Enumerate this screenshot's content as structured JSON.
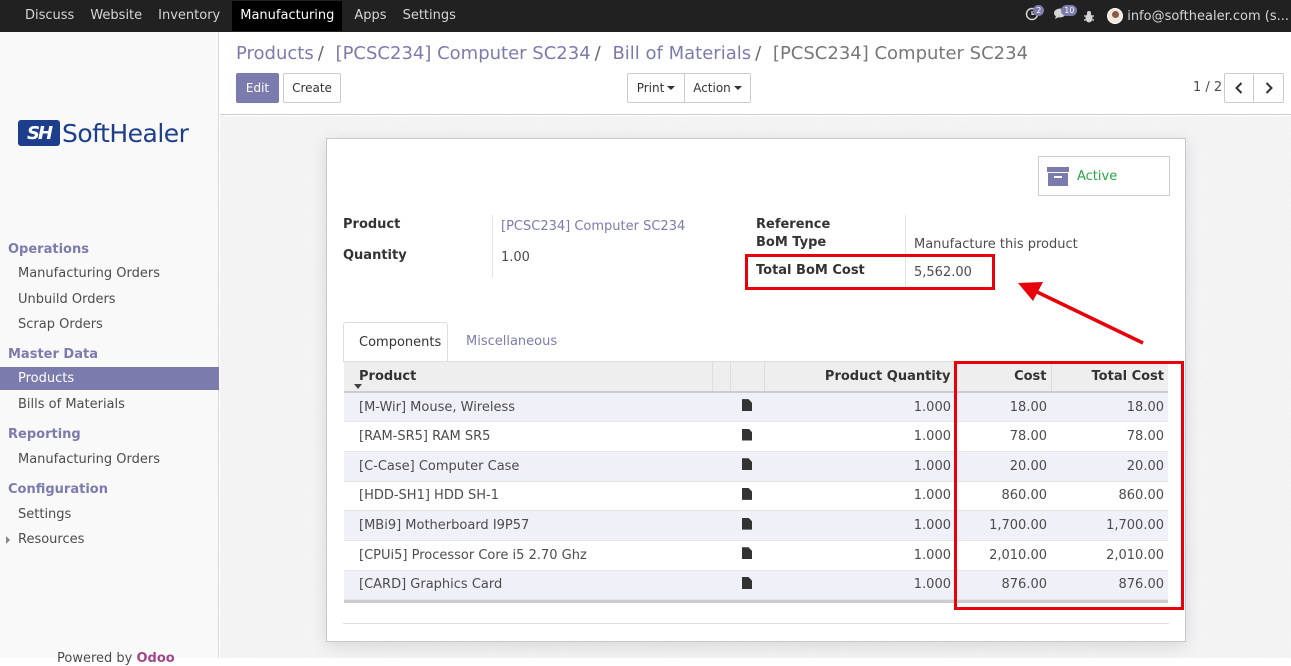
{
  "topbar": {
    "apps": [
      "Discuss",
      "Website",
      "Inventory",
      "Manufacturing",
      "Apps",
      "Settings"
    ],
    "active_app": "Manufacturing",
    "activity_badge": "2",
    "messages_badge": "10",
    "user_email": "info@softhealer.com (s..."
  },
  "sidebar": {
    "logo_mark": "SH",
    "logo_text": "SoftHealer",
    "sections": [
      {
        "title": "Operations",
        "items": [
          "Manufacturing Orders",
          "Unbuild Orders",
          "Scrap Orders"
        ]
      },
      {
        "title": "Master Data",
        "items": [
          "Products",
          "Bills of Materials"
        ]
      },
      {
        "title": "Reporting",
        "items": [
          "Manufacturing Orders"
        ]
      },
      {
        "title": "Configuration",
        "items": [
          "Settings",
          "Resources"
        ]
      }
    ],
    "active_item": "Products",
    "powered_by": "Powered by",
    "powered_brand": "Odoo"
  },
  "breadcrumb": [
    "Products",
    "[PCSC234] Computer SC234",
    "Bill of Materials",
    "[PCSC234] Computer SC234"
  ],
  "toolbar": {
    "edit": "Edit",
    "create": "Create",
    "print": "Print",
    "action": "Action",
    "pager": "1 / 2"
  },
  "form": {
    "active_label": "Active",
    "product_label": "Product",
    "product_value": "[PCSC234] Computer SC234",
    "quantity_label": "Quantity",
    "quantity_value": "1.00",
    "reference_label": "Reference",
    "bom_type_label": "BoM Type",
    "bom_type_value": "Manufacture this product",
    "total_cost_label": "Total BoM Cost",
    "total_cost_value": "5,562.00"
  },
  "tabs": [
    "Components",
    "Miscellaneous"
  ],
  "table": {
    "headers": {
      "product": "Product",
      "qty": "Product Quantity",
      "cost": "Cost",
      "total": "Total Cost"
    },
    "rows": [
      {
        "product": "[M-Wir] Mouse, Wireless",
        "qty": "1.000",
        "cost": "18.00",
        "total": "18.00"
      },
      {
        "product": "[RAM-SR5] RAM SR5",
        "qty": "1.000",
        "cost": "78.00",
        "total": "78.00"
      },
      {
        "product": "[C-Case] Computer Case",
        "qty": "1.000",
        "cost": "20.00",
        "total": "20.00"
      },
      {
        "product": "[HDD-SH1] HDD SH-1",
        "qty": "1.000",
        "cost": "860.00",
        "total": "860.00"
      },
      {
        "product": "[MBi9] Motherboard I9P57",
        "qty": "1.000",
        "cost": "1,700.00",
        "total": "1,700.00"
      },
      {
        "product": "[CPUi5] Processor Core i5 2.70 Ghz",
        "qty": "1.000",
        "cost": "2,010.00",
        "total": "2,010.00"
      },
      {
        "product": "[CARD] Graphics Card",
        "qty": "1.000",
        "cost": "876.00",
        "total": "876.00"
      }
    ]
  },
  "colors": {
    "accent": "#7c7bad",
    "highlight": "#e8000b",
    "active_green": "#28a745"
  }
}
